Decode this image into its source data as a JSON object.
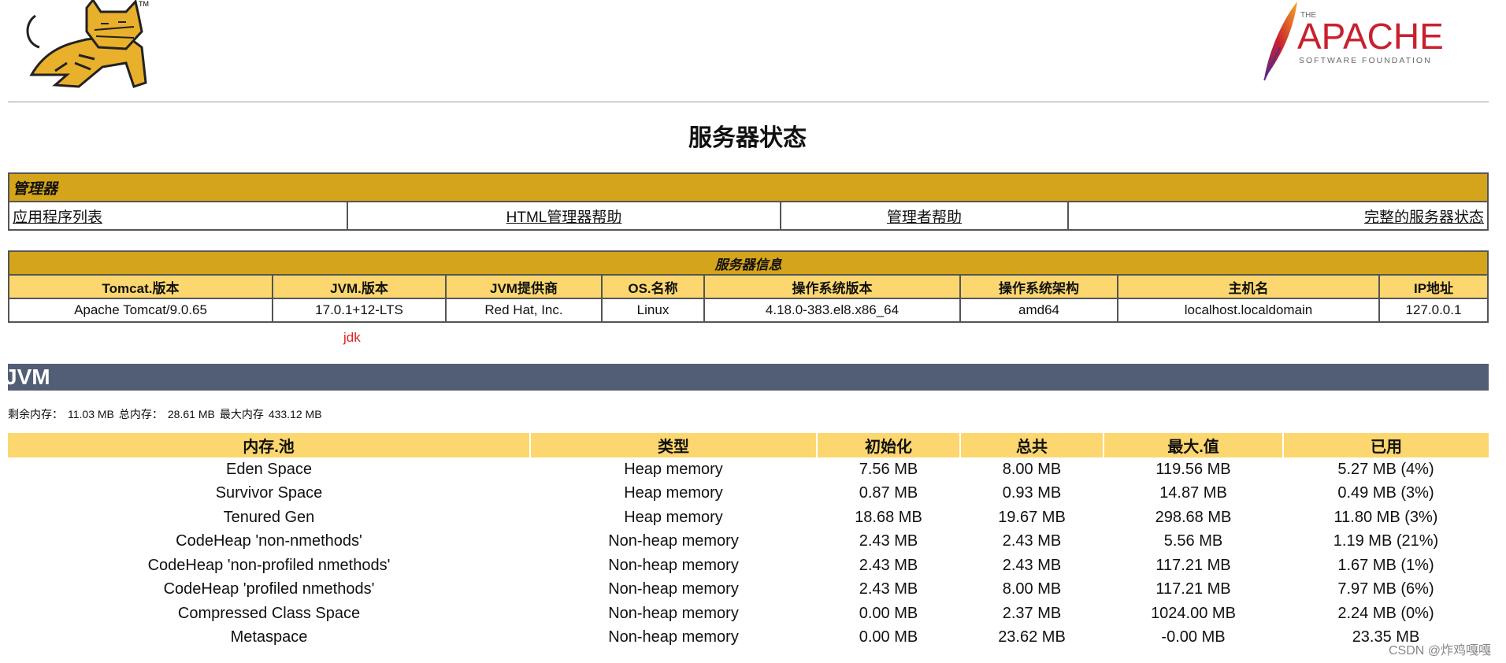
{
  "page_title": "服务器状态",
  "manager": {
    "section_title": "管理器",
    "links": [
      "应用程序列表",
      "HTML管理器帮助",
      "管理者帮助",
      "完整的服务器状态"
    ]
  },
  "server_info": {
    "section_title": "服务器信息",
    "headers": [
      "Tomcat.版本",
      "JVM.版本",
      "JVM提供商",
      "OS.名称",
      "操作系统版本",
      "操作系统架构",
      "主机名",
      "IP地址"
    ],
    "values": [
      "Apache Tomcat/9.0.65",
      "17.0.1+12-LTS",
      "Red Hat, Inc.",
      "Linux",
      "4.18.0-383.el8.x86_64",
      "amd64",
      "localhost.localdomain",
      "127.0.0.1"
    ],
    "annotation": "jdk"
  },
  "jvm": {
    "section_title": "JVM",
    "memory_summary": {
      "free_label": "剩余内存：",
      "free_value": "11.03 MB",
      "total_label": "总内存：",
      "total_value": "28.61 MB",
      "max_label": "最大内存",
      "max_value": "433.12 MB"
    },
    "pool_headers": [
      "内存.池",
      "类型",
      "初始化",
      "总共",
      "最大.值",
      "已用"
    ],
    "pools": [
      [
        "Eden Space",
        "Heap memory",
        "7.56 MB",
        "8.00 MB",
        "119.56 MB",
        "5.27 MB (4%)"
      ],
      [
        "Survivor Space",
        "Heap memory",
        "0.87 MB",
        "0.93 MB",
        "14.87 MB",
        "0.49 MB (3%)"
      ],
      [
        "Tenured Gen",
        "Heap memory",
        "18.68 MB",
        "19.67 MB",
        "298.68 MB",
        "11.80 MB (3%)"
      ],
      [
        "CodeHeap 'non-nmethods'",
        "Non-heap memory",
        "2.43 MB",
        "2.43 MB",
        "5.56 MB",
        "1.19 MB (21%)"
      ],
      [
        "CodeHeap 'non-profiled nmethods'",
        "Non-heap memory",
        "2.43 MB",
        "2.43 MB",
        "117.21 MB",
        "1.67 MB (1%)"
      ],
      [
        "CodeHeap 'profiled nmethods'",
        "Non-heap memory",
        "2.43 MB",
        "8.00 MB",
        "117.21 MB",
        "7.97 MB (6%)"
      ],
      [
        "Compressed Class Space",
        "Non-heap memory",
        "0.00 MB",
        "2.37 MB",
        "1024.00 MB",
        "2.24 MB (0%)"
      ],
      [
        "Metaspace",
        "Non-heap memory",
        "0.00 MB",
        "23.62 MB",
        "-0.00 MB",
        "23.35 MB"
      ]
    ]
  },
  "logos": {
    "tomcat_tm": "TM",
    "apache_the": "THE",
    "apache_name": "APACHE",
    "apache_sub": "SOFTWARE FOUNDATION"
  },
  "watermark": "CSDN @炸鸡嘎嘎",
  "colors": {
    "section_header": "#d4a41b",
    "column_header": "#fcd76f",
    "jvm_band": "#525d76",
    "annotation": "#e02020"
  }
}
